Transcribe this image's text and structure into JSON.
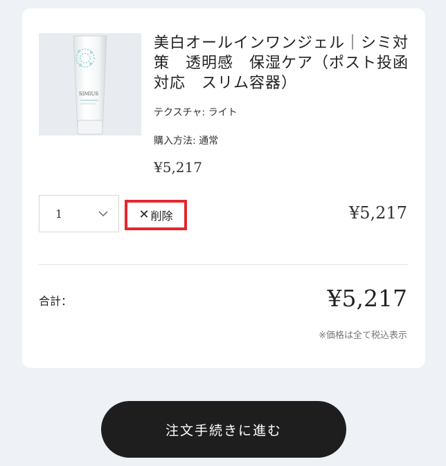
{
  "cart_item": {
    "title": "美白オールインワンジェル｜シミ対策　透明感　保湿ケア（ポスト投函対応　スリム容器）",
    "variant": "テクスチャ: ライト",
    "purchase_method": "購入方法: 通常",
    "unit_price": "¥5,217",
    "quantity": "1",
    "delete_label": "削除",
    "delete_icon": "close-icon",
    "line_price": "¥5,217",
    "product_brand_text": "SIMIUS"
  },
  "summary": {
    "total_label": "合計：",
    "total_price": "¥5,217",
    "tax_note": "※価格は全て税込表示"
  },
  "checkout": {
    "label": "注文手続きに進む"
  },
  "colors": {
    "background": "#eef1f5",
    "card": "#ffffff",
    "highlight_border": "#e3262b",
    "checkout_button": "#1e1e1e"
  }
}
